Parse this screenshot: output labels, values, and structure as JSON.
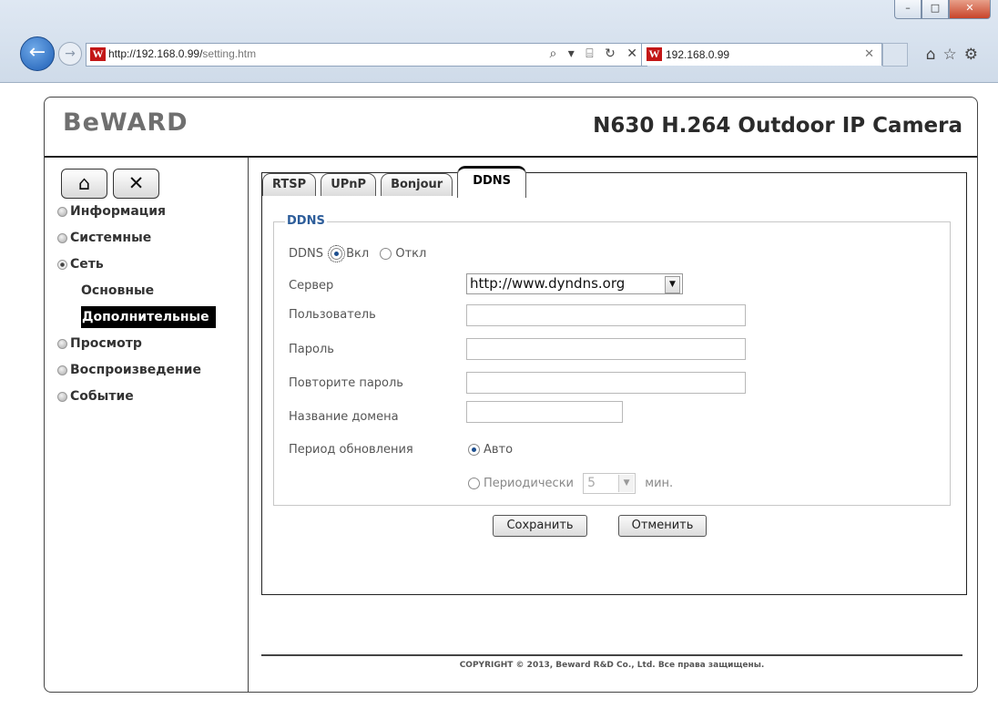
{
  "browser": {
    "url_host": "http://192.168.0.99/",
    "url_path": "setting.htm",
    "tab_title": "192.168.0.99",
    "favicon_letter": "W",
    "address_tools": "⌕ ▾ ⌸ ↻ ✕",
    "icons": [
      "home-icon",
      "star-icon",
      "gear-icon"
    ]
  },
  "header": {
    "logo": "BeWARD",
    "model": "N630 H.264 Outdoor IP Camera"
  },
  "sidebar": {
    "menu": [
      {
        "label": "Информация"
      },
      {
        "label": "Системные"
      },
      {
        "label": "Сеть"
      },
      {
        "label": "Просмотр"
      },
      {
        "label": "Воспроизведение"
      },
      {
        "label": "Событие"
      }
    ],
    "network_sub": [
      {
        "label": "Основные"
      },
      {
        "label": "Дополнительные"
      }
    ]
  },
  "tabs": [
    {
      "label": "RTSP"
    },
    {
      "label": "UPnP"
    },
    {
      "label": "Bonjour"
    },
    {
      "label": "DDNS"
    }
  ],
  "form": {
    "legend": "DDNS",
    "ddns_label": "DDNS",
    "on_label": "Вкл",
    "off_label": "Откл",
    "server_label": "Сервер",
    "server_value": "http://www.dyndns.org",
    "user_label": "Пользователь",
    "user_value": "",
    "password_label": "Пароль",
    "password_value": "",
    "repeat_password_label": "Повторите пароль",
    "repeat_password_value": "",
    "domain_label": "Название домена",
    "domain_value": "",
    "period_label": "Период обновления",
    "auto_label": "Авто",
    "periodic_label": "Периодически",
    "periodic_value": "5",
    "min_label": "мин."
  },
  "buttons": {
    "save": "Сохранить",
    "cancel": "Отменить"
  },
  "footer": {
    "copyright": "COPYRIGHT © 2013, Beward R&D Co., Ltd. Все права защищены."
  }
}
